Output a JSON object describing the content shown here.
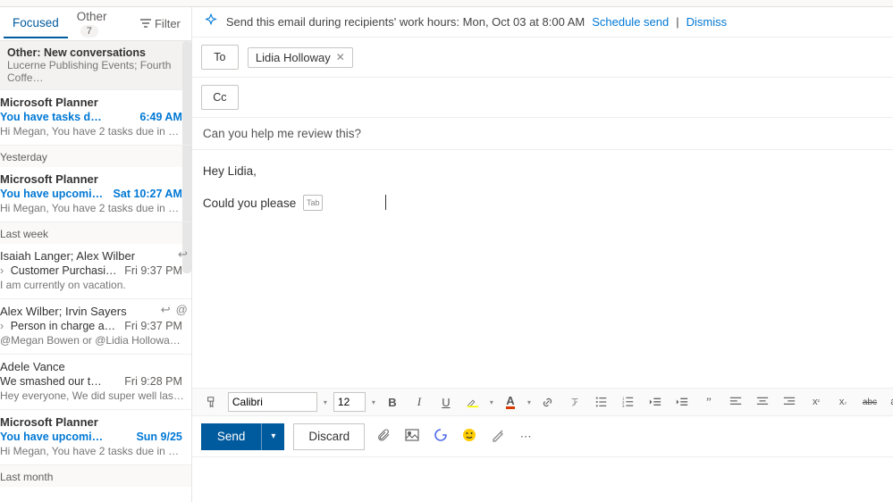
{
  "tabs": {
    "focused": "Focused",
    "other": "Other",
    "other_badge": "7",
    "filter": "Filter"
  },
  "other_new": {
    "title": "Other: New conversations",
    "preview": "Lucerne Publishing Events; Fourth Coffe…"
  },
  "groups": {
    "yesterday": "Yesterday",
    "lastweek": "Last week",
    "lastmonth": "Last month"
  },
  "items": [
    {
      "from": "Microsoft Planner",
      "subj": "You have tasks due today!",
      "time": "6:49 AM",
      "prev": "Hi Megan, You have 2 tasks due in …",
      "unread": true
    },
    {
      "from": "Microsoft Planner",
      "subj": "You have upcoming t…",
      "time": "Sat 10:27 AM",
      "prev": "Hi Megan, You have 2 tasks due in …",
      "unread": true
    },
    {
      "from": "Isaiah Langer; Alex Wilber",
      "subj": "Customer Purchasing…",
      "time": "Fri 9:37 PM",
      "prev": "I am currently on vacation.",
      "reply": true
    },
    {
      "from": "Alex Wilber; Irvin Sayers",
      "subj": "Person in charge at N…",
      "time": "Fri 9:37 PM",
      "prev": "@Megan Bowen or @Lidia Hollowa…",
      "mention": true,
      "reply": true,
      "replyarrow": true
    },
    {
      "from": "Adele Vance",
      "subj": "We smashed our targets…",
      "time": "Fri 9:28 PM",
      "prev": "Hey everyone, We did super well las…"
    },
    {
      "from": "Microsoft Planner",
      "subj": "You have upcoming task…",
      "time": "Sun 9/25",
      "prev": "Hi Megan, You have 2 tasks due in …",
      "unread": true
    }
  ],
  "infobar": {
    "text": "Send this email during recipients' work hours: Mon, Oct 03 at 8:00 AM ",
    "schedule": "Schedule send",
    "sep": " | ",
    "dismiss": "Dismiss"
  },
  "compose": {
    "to_label": "To",
    "cc_label": "Cc",
    "recipient": "Lidia Holloway",
    "subject": "Can you help me review this?",
    "body_line1": "Hey Lidia,",
    "body_line2": "Could you please",
    "tab_hint": "Tab"
  },
  "fmt": {
    "font": "Calibri",
    "size": "12"
  },
  "actions": {
    "send": "Send",
    "discard": "Discard"
  }
}
